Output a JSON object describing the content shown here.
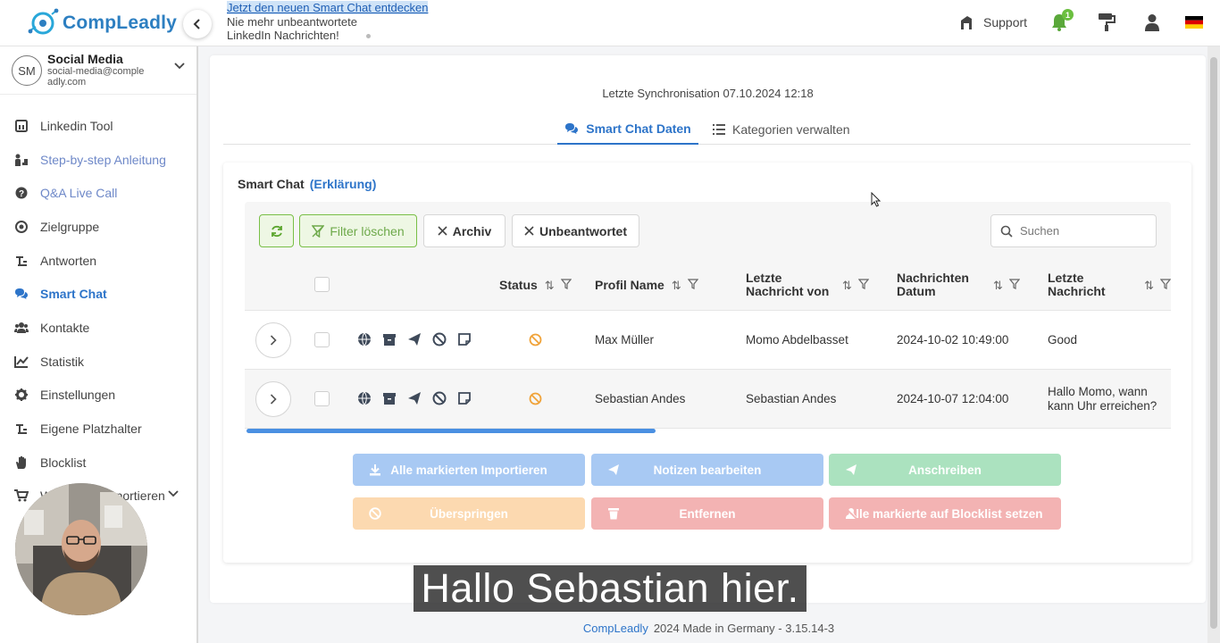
{
  "app": {
    "logo_text": "CompLeadly",
    "announcement": {
      "link": "Jetzt den neuen Smart Chat entdecken",
      "line2": "Nie mehr unbeantwortete",
      "line3": "LinkedIn Nachrichten!"
    },
    "support_label": "Support",
    "bell_count": "1",
    "language_flag": "german-flag-icon"
  },
  "account": {
    "initials": "SM",
    "name": "Social Media",
    "email": "social-media@compleadly.com"
  },
  "sidebar": {
    "items": [
      {
        "label": "Linkedin Tool",
        "icon": "linkedin-icon"
      },
      {
        "label": "Step-by-step Anleitung",
        "icon": "steps-icon"
      },
      {
        "label": "Q&A Live Call",
        "icon": "question-icon"
      },
      {
        "label": "Zielgruppe",
        "icon": "target-icon"
      },
      {
        "label": "Antworten",
        "icon": "answers-icon"
      },
      {
        "label": "Smart Chat",
        "icon": "chat-icon"
      },
      {
        "label": "Kontakte",
        "icon": "contacts-icon"
      },
      {
        "label": "Statistik",
        "icon": "chart-icon"
      },
      {
        "label": "Einstellungen",
        "icon": "gear-icon"
      },
      {
        "label": "Eigene Platzhalter",
        "icon": "placeholder-icon"
      },
      {
        "label": "Blocklist",
        "icon": "hand-icon"
      },
      {
        "label": "Webseiten importieren",
        "icon": "cart-icon"
      }
    ]
  },
  "page": {
    "sync": "Letzte Synchronisation 07.10.2024 12:18",
    "tabs": [
      {
        "label": "Smart Chat Daten",
        "active": true
      },
      {
        "label": "Kategorien verwalten",
        "active": false
      }
    ],
    "card_title": "Smart Chat",
    "card_explain": "(Erklärung)",
    "toolbar": {
      "filter_label": "Filter löschen",
      "archive_label": "Archiv",
      "unanswered_label": "Unbeantwortet",
      "search_placeholder": "Suchen"
    },
    "table": {
      "headers": {
        "status": "Status",
        "profile": "Profil Name",
        "last_from": "Letzte Nachricht von",
        "date": "Nachrichten Datum",
        "last_msg": "Letzte Nachricht"
      },
      "rows": [
        {
          "profile": "Max Müller",
          "last_from": "Momo Abdelbasset",
          "date": "2024-10-02 10:49:00",
          "last_msg": "Good"
        },
        {
          "profile": "Sebastian Andes",
          "last_from": "Sebastian Andes",
          "date": "2024-10-07 12:04:00",
          "last_msg": "Hallo Momo, wann kann Uhr erreichen?"
        }
      ]
    },
    "actions": {
      "import": "Alle markierten Importieren",
      "notes": "Notizen bearbeiten",
      "write": "Anschreiben",
      "skip": "Überspringen",
      "remove": "Entfernen",
      "blocklist": "Alle markierte auf Blocklist setzen"
    }
  },
  "subtitle": "Hallo Sebastian hier.",
  "footer": {
    "brand": "CompLeadly",
    "text": "2024 Made in Germany - 3.15.14-3"
  },
  "colors": {
    "accent": "#2d74c9",
    "green": "#79bf46",
    "blue_btn": "#a8c9f3",
    "green_btn": "#abe2bf",
    "orange_btn": "#fcd9b0",
    "red_btn": "#f3b3b3"
  }
}
